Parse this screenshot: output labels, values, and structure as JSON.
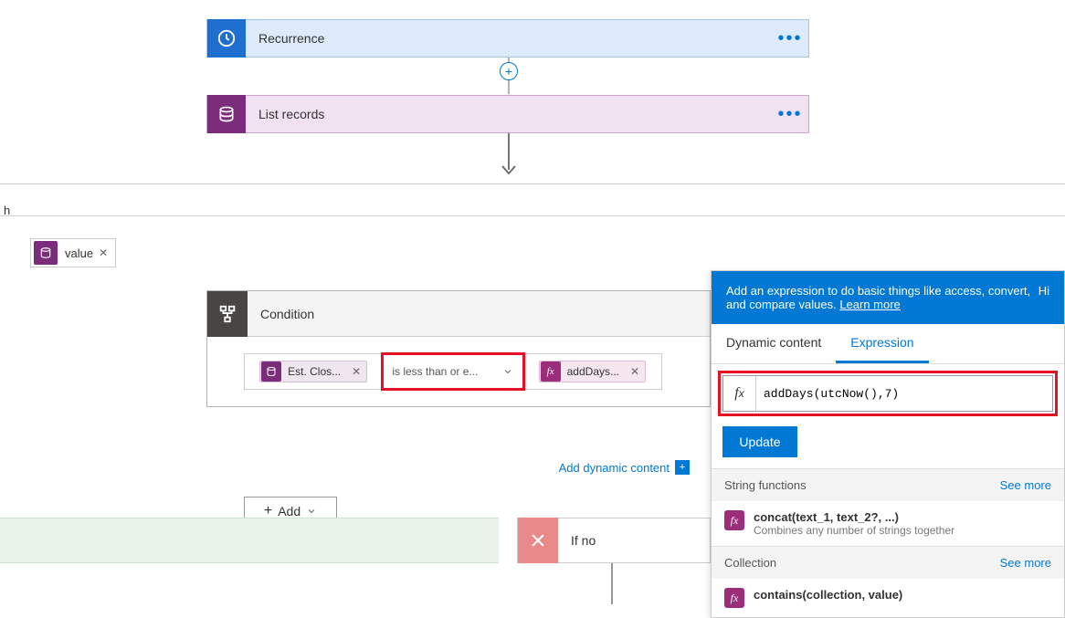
{
  "steps": {
    "recurrence": {
      "title": "Recurrence"
    },
    "list_records": {
      "title": "List records"
    }
  },
  "apply_to_each": {
    "label": "h",
    "input_token": "value"
  },
  "condition": {
    "title": "Condition",
    "left_token": "Est. Clos...",
    "operator": "is less than or e...",
    "right_token": "addDays...",
    "add_dynamic_content": "Add dynamic content",
    "add_button": "Add"
  },
  "branches": {
    "if_no": "If no"
  },
  "expression_panel": {
    "banner_text": "Add an expression to do basic things like access, convert, and compare values.",
    "learn_more": "Learn more",
    "hide": "Hi",
    "tab_dynamic": "Dynamic content",
    "tab_expression": "Expression",
    "input_value": "addDays(utcNow(),7)",
    "update_label": "Update",
    "sections": [
      {
        "title": "String functions",
        "see_more": "See more",
        "items": [
          {
            "title": "concat(text_1, text_2?, ...)",
            "desc": "Combines any number of strings together"
          }
        ]
      },
      {
        "title": "Collection",
        "see_more": "See more",
        "items": [
          {
            "title": "contains(collection, value)",
            "desc": ""
          }
        ]
      }
    ]
  }
}
